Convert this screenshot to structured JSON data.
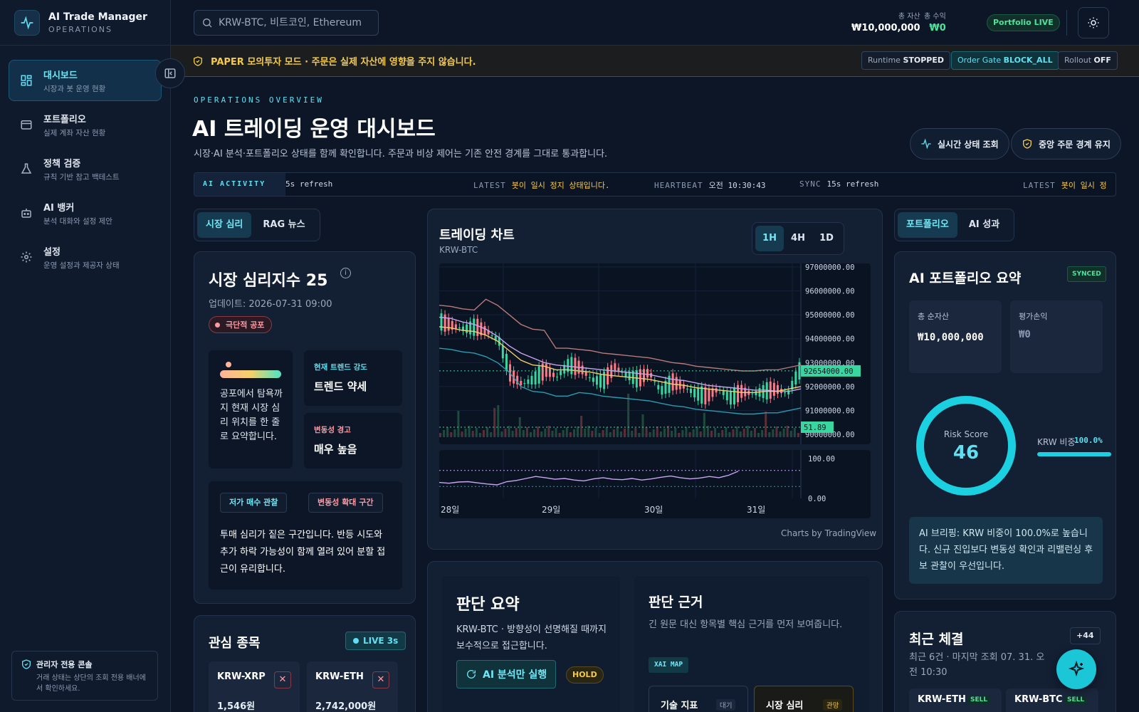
{
  "app": {
    "title": "AI Trade Manager",
    "subtitle": "OPERATIONS"
  },
  "sidebar": {
    "items": [
      {
        "label": "대시보드",
        "desc": "시장과 봇 운영 현황",
        "icon": "dashboard-icon",
        "active": true
      },
      {
        "label": "포트폴리오",
        "desc": "실제 계좌 자산 현황",
        "icon": "wallet-icon"
      },
      {
        "label": "정책 검증",
        "desc": "규칙 기반 참고 백테스트",
        "icon": "flask-icon"
      },
      {
        "label": "AI 뱅커",
        "desc": "분석 대화와 설정 제안",
        "icon": "robot-icon"
      },
      {
        "label": "설정",
        "desc": "운영 설정과 제공자 상태",
        "icon": "gear-icon"
      }
    ],
    "admin": {
      "title": "관리자 전용 콘솔",
      "desc": "거래 상태는 상단의 조회 전용 배너에서 확인하세요."
    }
  },
  "header": {
    "search_placeholder": "KRW-BTC, 비트코인, Ethereum",
    "total_assets_label": "총 자산",
    "total_assets_value": "₩10,000,000",
    "total_profit_label": "총 수익",
    "total_profit_value": "₩0",
    "portfolio_live": "Portfolio LIVE"
  },
  "banner": {
    "text": "PAPER 모의투자 모드 · 주문은 실제 자산에 영향을 주지 않습니다.",
    "runtime_label": "Runtime",
    "runtime_value": "STOPPED",
    "order_gate_label": "Order Gate",
    "order_gate_value": "BLOCK_ALL",
    "rollout_label": "Rollout",
    "rollout_value": "OFF"
  },
  "page": {
    "eyebrow": "OPERATIONS OVERVIEW",
    "title": "AI 트레이딩 운영 대시보드",
    "desc": "시장·AI 분석·포트폴리오 상태를 함께 확인합니다. 주문과 비상 제어는 기존 안전 경계를 그대로 통과합니다.",
    "btn_realtime": "실시간 상태 조회",
    "btn_gate": "중앙 주문 경계 유지"
  },
  "ticker": {
    "tag": "AI ACTIVITY",
    "head_fragment": "5s refresh",
    "latest_label": "LATEST",
    "latest_value": "봇이 일시 정지 상태입니다.",
    "heartbeat_label": "HEARTBEAT",
    "heartbeat_value": "오전 10:30:43",
    "sync_label": "SYNC",
    "sync_value": "15s refresh",
    "tail_value": "봇이 일시 정"
  },
  "left": {
    "tabs": [
      "시장 심리",
      "RAG 뉴스"
    ],
    "sentiment": {
      "title": "시장 심리지수 25",
      "updated": "업데이트: 2026-07-31 09:00",
      "badge": "극단적 공포",
      "gauge_level": 0.14,
      "summary": "공포에서 탐욕까지 현재 시장 심리 위치를 한 줄로 요약합니다.",
      "trend_label": "현재 트렌드 강도",
      "trend_value": "트렌드 약세",
      "vol_label": "변동성 경고",
      "vol_value": "매우 높음",
      "chip1": "저가 매수 관찰",
      "chip2": "변동성 확대 구간",
      "comment": "투매 심리가 짙은 구간입니다. 반등 시도와 추가 하락 가능성이 함께 열려 있어 분할 접근이 유리합니다."
    },
    "watch": {
      "title": "관심 종목",
      "live": "LIVE 3s",
      "items": [
        {
          "symbol": "KRW-XRP",
          "price": "1,546원"
        },
        {
          "symbol": "KRW-ETH",
          "price": "2,742,000원"
        }
      ]
    }
  },
  "chart_panel": {
    "title": "트레이딩 차트",
    "symbol": "KRW-BTC",
    "intervals": [
      "1H",
      "4H",
      "1D"
    ],
    "credit": "Charts by TradingView",
    "price_label": "92654000.00",
    "vol_label": "51.89"
  },
  "chart_data": {
    "type": "line",
    "title": "",
    "xlabel": "",
    "ylabel": "",
    "ylim": [
      90000000,
      97000000
    ],
    "x_ticks": [
      "28일",
      "29일",
      "30일",
      "31일"
    ],
    "y_ticks": [
      "97000000.00",
      "96000000.00",
      "95000000.00",
      "94000000.00",
      "93000000.00",
      "92000000.00",
      "91000000.00",
      "90000000.00"
    ],
    "last_price": 92654000,
    "series": [
      {
        "values": [
          94700000,
          94550000,
          94400000,
          94500000,
          94300000,
          93900000,
          92500000,
          92100000,
          92300000,
          92700000,
          92400000,
          92900000,
          92800000,
          92300000,
          92200000,
          92800000,
          92500000,
          92300000,
          92600000,
          91800000,
          92200000,
          92000000,
          91700000,
          91600000,
          91900000,
          91500000,
          91800000,
          91700000,
          91800000,
          91900000,
          91700000,
          92654000
        ]
      },
      {
        "values": [
          94900000,
          94850000,
          94700000,
          94600000,
          94400000,
          94100000,
          93700000,
          93400000,
          93200000,
          93000000,
          92900000,
          92850000,
          92800000,
          92750000,
          92700000,
          92650000,
          92600000,
          92550000,
          92500000,
          92400000,
          92300000,
          92250000,
          92150000,
          92050000,
          92000000,
          91950000,
          91900000,
          91850000,
          91850000,
          91800000,
          91800000,
          91900000
        ]
      },
      {
        "values": [
          94500000,
          94450000,
          94350000,
          94300000,
          94150000,
          93900000,
          93500000,
          93100000,
          92900000,
          92850000,
          92700000,
          92700000,
          92650000,
          92600000,
          92500000,
          92450000,
          92400000,
          92350000,
          92300000,
          92200000,
          92100000,
          92050000,
          91950000,
          91900000,
          91850000,
          91800000,
          91750000,
          91750000,
          91800000,
          91800000,
          91900000,
          92000000
        ]
      }
    ],
    "rsi": {
      "ylim": [
        0,
        100
      ],
      "ticks": [
        "100.00",
        "0.00"
      ],
      "values": [
        40,
        38,
        41,
        42,
        39,
        36,
        34,
        42,
        45,
        50,
        55,
        52,
        48,
        50,
        46,
        44,
        49,
        52,
        48,
        47,
        50,
        46,
        49,
        53,
        56,
        52,
        49,
        51,
        55,
        52,
        58,
        68
      ]
    }
  },
  "judgement": {
    "title": "판단 요약",
    "desc": "KRW-BTC · 방향성이 선명해질 때까지 보수적으로 접근합니다.",
    "btn": "AI 분석만 실행",
    "hold": "HOLD"
  },
  "basis": {
    "title": "판단 근거",
    "desc": "긴 원문 대신 항목별 핵심 근거를 먼저 보여줍니다.",
    "tag": "XAI MAP",
    "card1_title": "기술 지표",
    "card1_state": "대기",
    "card2_title": "시장 심리",
    "card2_state": "관망"
  },
  "right": {
    "tabs": [
      "포트폴리오",
      "AI 성과"
    ],
    "summary": {
      "title": "AI 포트폴리오 요약",
      "synced": "SYNCED",
      "net_label": "총 순자산",
      "net_value": "₩10,000,000",
      "pnl_label": "평가손익",
      "pnl_value": "₩0",
      "risk_label": "Risk Score",
      "risk_value": "46",
      "krw_label": "KRW 비중",
      "krw_value": "100.0%",
      "krw_ratio": 1.0,
      "briefing": "AI 브리핑: KRW 비중이 100.0%로 높습니다. 신규 진입보다 변동성 확인과 리밸런싱 후보 관찰이 우선입니다."
    },
    "recent": {
      "title": "최근 체결",
      "desc": "최근 6건 · 마지막 조회 07. 31. 오전 10:30",
      "more": "+44",
      "items": [
        {
          "symbol": "KRW-ETH",
          "side": "SELL"
        },
        {
          "symbol": "KRW-BTC",
          "side": "SELL"
        }
      ]
    }
  },
  "colors": {
    "accent": "#5fe0f0",
    "warn": "#f5c94a",
    "danger": "#ff9aa3",
    "up": "#3ad6a0",
    "down": "#ff7a85"
  }
}
